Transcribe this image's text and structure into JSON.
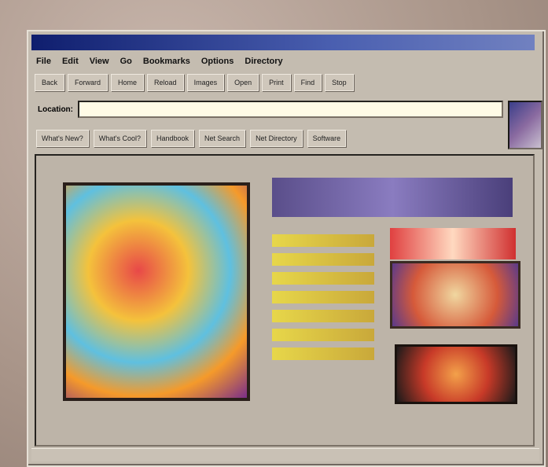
{
  "menubar": {
    "items": [
      "File",
      "Edit",
      "View",
      "Go",
      "Bookmarks",
      "Options",
      "Directory"
    ]
  },
  "toolbar": {
    "buttons": [
      "Back",
      "Forward",
      "Home",
      "Reload",
      "Images",
      "Open",
      "Print",
      "Find",
      "Stop"
    ]
  },
  "address": {
    "label": "Location:",
    "url": ""
  },
  "links": {
    "buttons": [
      "What's New?",
      "What's Cool?",
      "Handbook",
      "Net Search",
      "Net Directory",
      "Software"
    ]
  },
  "content": {
    "caption": ""
  },
  "status": {
    "text": ""
  }
}
